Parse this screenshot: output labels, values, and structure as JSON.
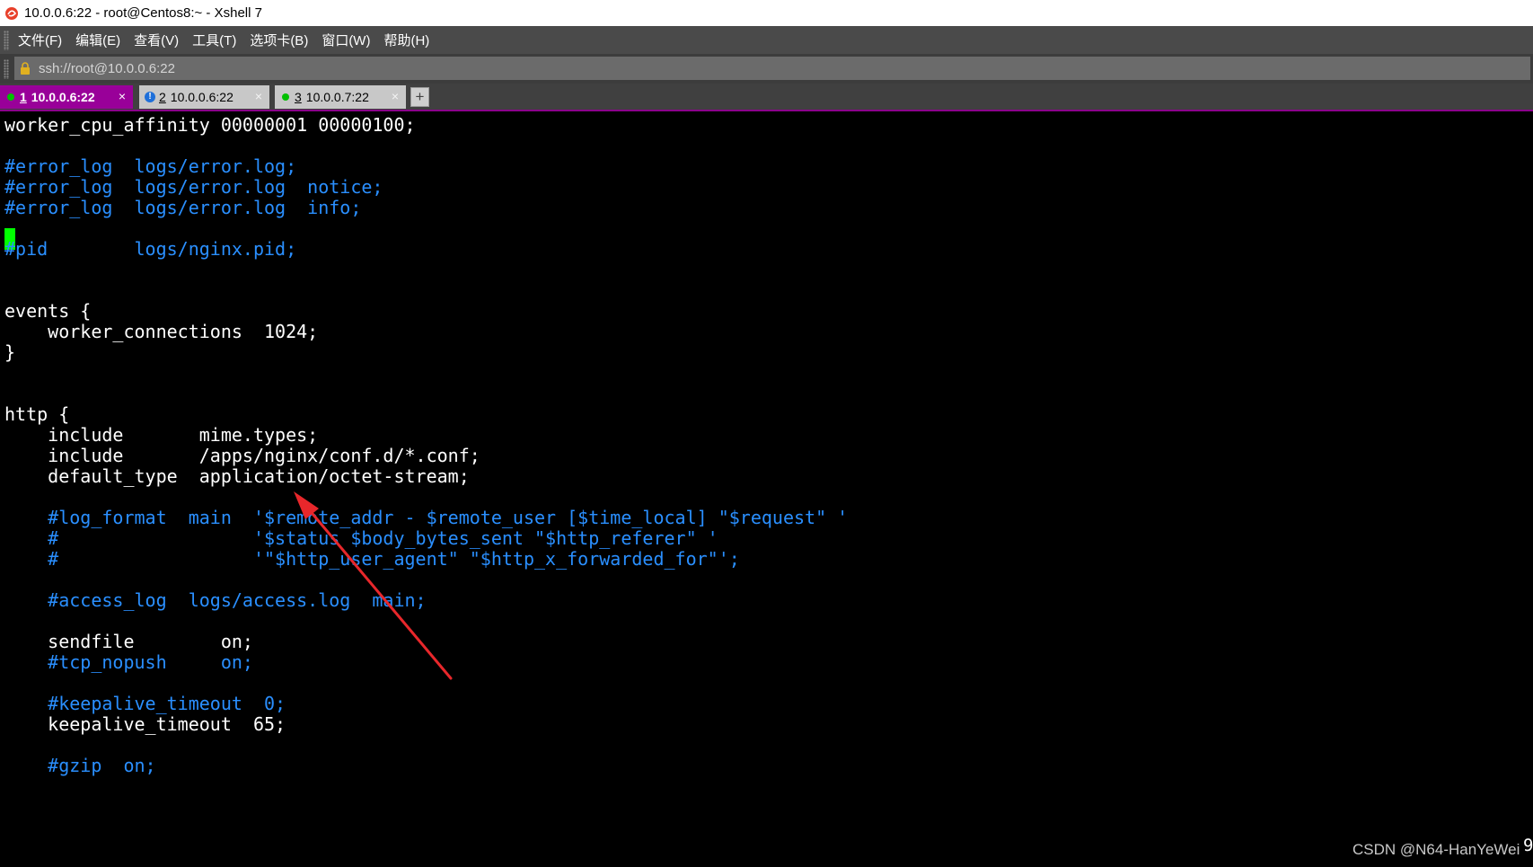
{
  "window": {
    "title": "10.0.0.6:22 - root@Centos8:~ - Xshell 7"
  },
  "menu": [
    "文件(F)",
    "编辑(E)",
    "查看(V)",
    "工具(T)",
    "选项卡(B)",
    "窗口(W)",
    "帮助(H)"
  ],
  "address": {
    "value": "ssh://root@10.0.0.6:22"
  },
  "tabs": [
    {
      "num": "1",
      "label": "10.0.0.6:22",
      "active": true,
      "status": "connected"
    },
    {
      "num": "2",
      "label": "10.0.0.6:22",
      "active": false,
      "status": "warning"
    },
    {
      "num": "3",
      "label": "10.0.0.7:22",
      "active": false,
      "status": "connected"
    }
  ],
  "tab_close": "×",
  "new_tab": "+",
  "terminal": {
    "lines": [
      "worker_cpu_affinity 00000001 00000100;",
      "",
      "#error_log  logs/error.log;",
      "#error_log  logs/error.log  notice;",
      "#error_log  logs/error.log  info;",
      "",
      "#pid        logs/nginx.pid;",
      "",
      "",
      "events {",
      "    worker_connections  1024;",
      "}",
      "",
      "",
      "http {",
      "    include       mime.types;",
      "    include       /apps/nginx/conf.d/*.conf;",
      "    default_type  application/octet-stream;",
      "",
      "    #log_format  main  '$remote_addr - $remote_user [$time_local] \"$request\" '",
      "    #                  '$status $body_bytes_sent \"$http_referer\" '",
      "    #                  '\"$http_user_agent\" \"$http_x_forwarded_for\"';",
      "",
      "    #access_log  logs/access.log  main;",
      "",
      "    sendfile        on;",
      "    #tcp_nopush     on;",
      "",
      "    #keepalive_timeout  0;",
      "    keepalive_timeout  65;",
      "",
      "    #gzip  on;"
    ],
    "colors": {
      "text": "#ffffff",
      "comment": "#2a8fff",
      "cursor": "#00ff00",
      "background": "#000000"
    }
  },
  "annotation": {
    "color": "#e8272b"
  },
  "watermark": "CSDN @N64-HanYeWei",
  "edge_char": "9",
  "theme": {
    "accent": "#990099",
    "menubar": "#4a4a4a"
  }
}
